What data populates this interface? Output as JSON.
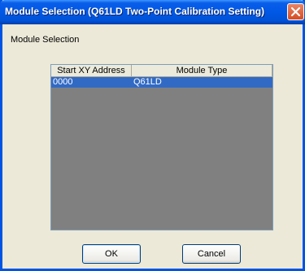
{
  "window": {
    "title": "Module Selection (Q61LD Two-Point Calibration Setting)"
  },
  "group": {
    "label": "Module Selection"
  },
  "list": {
    "columns": [
      "Start XY Address",
      "Module Type"
    ],
    "rows": [
      {
        "address": "0000",
        "module_type": "Q61LD",
        "selected": true
      }
    ]
  },
  "buttons": {
    "ok": "OK",
    "cancel": "Cancel"
  },
  "icons": {
    "close": "close-icon"
  },
  "colors": {
    "titlebar": "#0058e6",
    "selection": "#316ac5",
    "list_background": "#808080",
    "close_button": "#d64d24"
  }
}
